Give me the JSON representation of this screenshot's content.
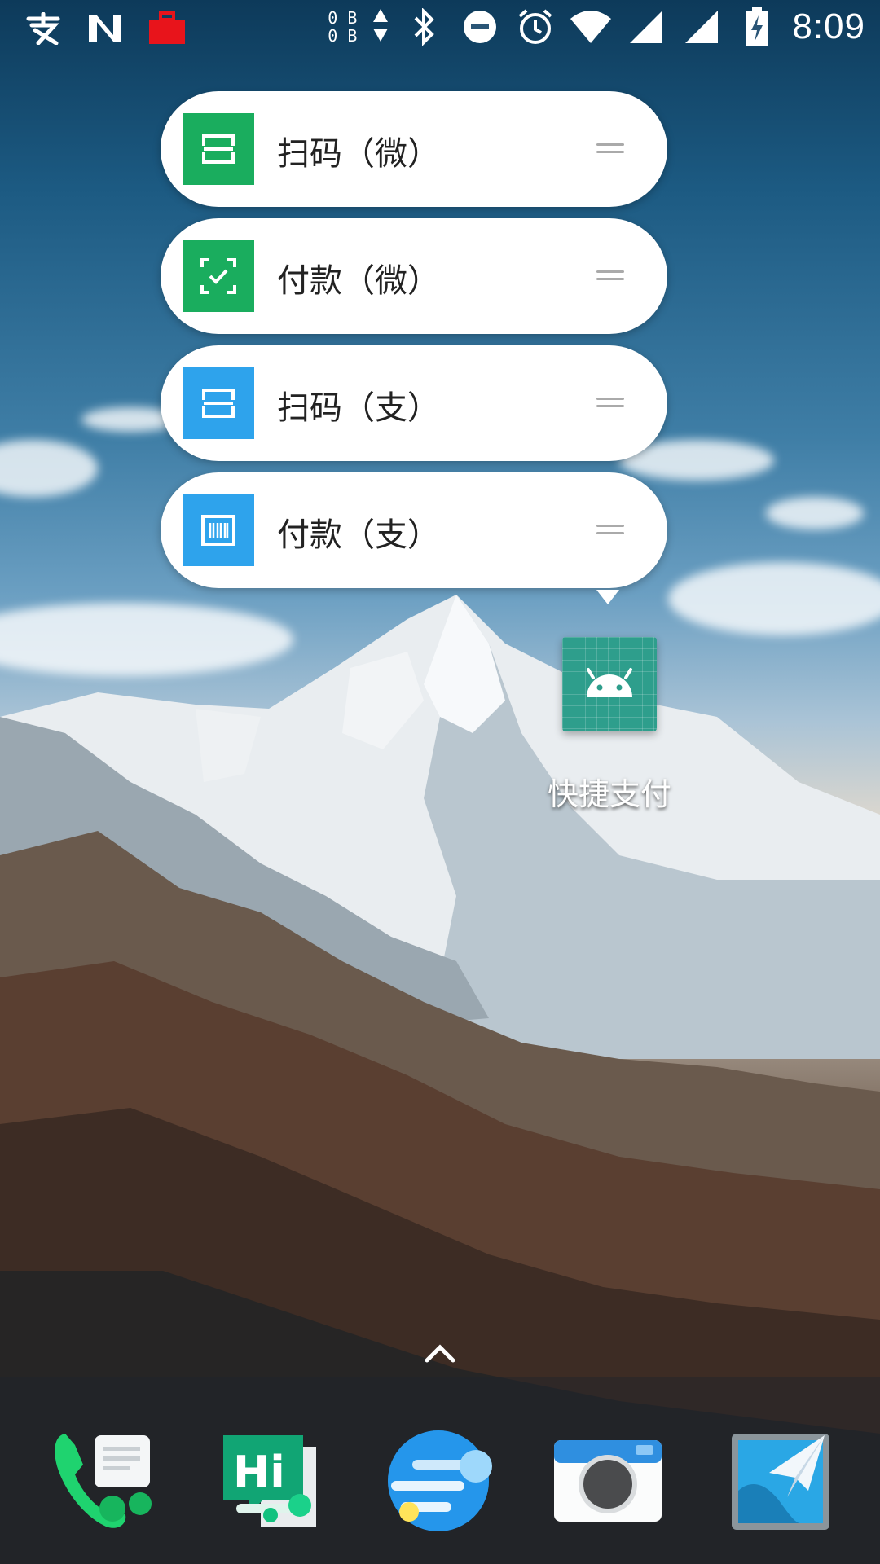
{
  "status_bar": {
    "time": "8:09",
    "net_speed_up": "0 B",
    "net_speed_down": "0 B",
    "left_icons": [
      "alipay-icon",
      "n-logo-icon",
      "red-briefcase-icon"
    ],
    "right_icons": [
      "bluetooth-icon",
      "do-not-disturb-icon",
      "alarm-icon",
      "wifi-icon",
      "signal-icon",
      "signal-icon-2",
      "battery-charging-icon"
    ]
  },
  "shortcuts": [
    {
      "label": "扫码（微）",
      "icon": "scan-icon",
      "color": "#1aad5e"
    },
    {
      "label": "付款（微）",
      "icon": "pay-check-icon",
      "color": "#1aad5e"
    },
    {
      "label": "扫码（支）",
      "icon": "scan-icon",
      "color": "#2ea3ec"
    },
    {
      "label": "付款（支）",
      "icon": "barcode-icon",
      "color": "#2ea3ec"
    }
  ],
  "app": {
    "label": "快捷支付",
    "icon": "android-icon",
    "color": "#2e9e8c"
  },
  "dock": {
    "items": [
      {
        "name": "phone-app-icon"
      },
      {
        "name": "messages-app-icon"
      },
      {
        "name": "browser-app-icon"
      },
      {
        "name": "camera-app-icon"
      },
      {
        "name": "gallery-app-icon"
      }
    ]
  }
}
